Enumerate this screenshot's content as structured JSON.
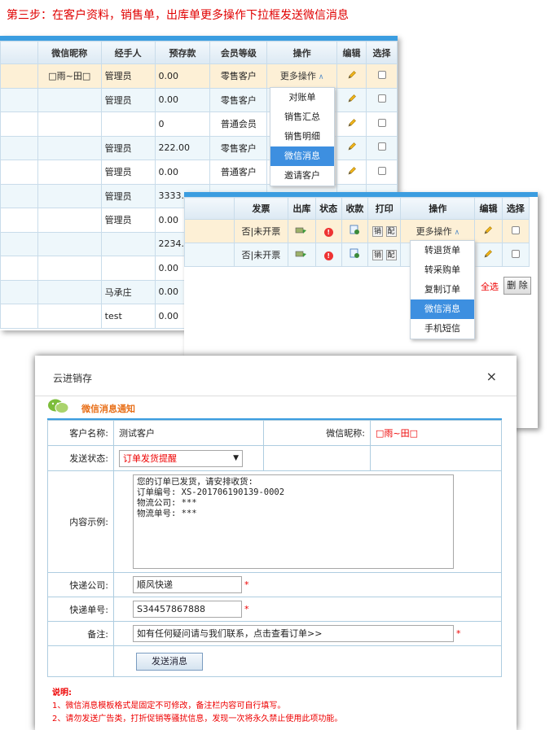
{
  "step_title": "第三步：在客户资料，销售单，出库单更多操作下拉框发送微信消息",
  "customer_table": {
    "headers": [
      "微信昵称",
      "经手人",
      "预存款",
      "会员等级",
      "操作",
      "编辑",
      "选择"
    ],
    "rows": [
      {
        "nick": "□雨~田□",
        "handler": "管理员",
        "deposit": "0.00",
        "level": "零售客户"
      },
      {
        "nick": "",
        "handler": "管理员",
        "deposit": "0.00",
        "level": "零售客户"
      },
      {
        "nick": "",
        "handler": "",
        "deposit": "0",
        "level": "普通会员"
      },
      {
        "nick": "",
        "handler": "管理员",
        "deposit": "222.00",
        "level": "零售客户"
      },
      {
        "nick": "",
        "handler": "管理员",
        "deposit": "0.00",
        "level": "普通客户"
      },
      {
        "nick": "",
        "handler": "管理员",
        "deposit": "3333.",
        "level": ""
      },
      {
        "nick": "",
        "handler": "管理员",
        "deposit": "0.00",
        "level": ""
      },
      {
        "nick": "",
        "handler": "",
        "deposit": "2234.",
        "level": ""
      },
      {
        "nick": "",
        "handler": "",
        "deposit": "0.00",
        "level": ""
      },
      {
        "nick": "",
        "handler": "马承庄",
        "deposit": "0.00",
        "level": ""
      },
      {
        "nick": "",
        "handler": "test",
        "deposit": "0.00",
        "level": ""
      }
    ],
    "more_label": "更多操作",
    "menu": [
      "对账单",
      "销售汇总",
      "销售明细",
      "微信消息",
      "邀请客户"
    ]
  },
  "order_table": {
    "headers": [
      "发票",
      "出库",
      "状态",
      "收款",
      "打印",
      "操作",
      "编辑",
      "选择"
    ],
    "rows": [
      {
        "invoice": "否|未开票",
        "print1": "销",
        "print2": "配"
      },
      {
        "invoice": "否|未开票",
        "print1": "销",
        "print2": "配"
      }
    ],
    "more_label": "更多操作",
    "menu": [
      "转退货单",
      "转采购单",
      "复制订单",
      "微信消息",
      "手机短信"
    ],
    "select_all": "全选",
    "delete_label": "删 除"
  },
  "dialog": {
    "title": "云进销存",
    "close": "×",
    "section_title": "微信消息通知",
    "customer_label": "客户名称:",
    "customer_value": "测试客户",
    "nick_label": "微信昵称:",
    "nick_value": "□雨~田□",
    "status_label": "发送状态:",
    "status_value": "订单发货提醒",
    "content_label": "内容示例:",
    "content_value": "您的订单已发货，请安排收货:\n订单编号: XS-201706190139-0002\n物流公司: ***\n物流单号: ***",
    "express_label": "快递公司:",
    "express_value": "顺风快递",
    "tracking_label": "快递单号:",
    "tracking_value": "S34457867888",
    "remark_label": "备注:",
    "remark_value": "如有任何疑问请与我们联系，点击查看订单>>",
    "required": "*",
    "send_button": "发送消息",
    "notes": [
      "说明:",
      "1、微信消息模板格式是固定不可修改，备注栏内容可自行填写。",
      "2、请勿发送广告类，打折促销等骚扰信息，发现一次将永久禁止使用此项功能。"
    ]
  }
}
